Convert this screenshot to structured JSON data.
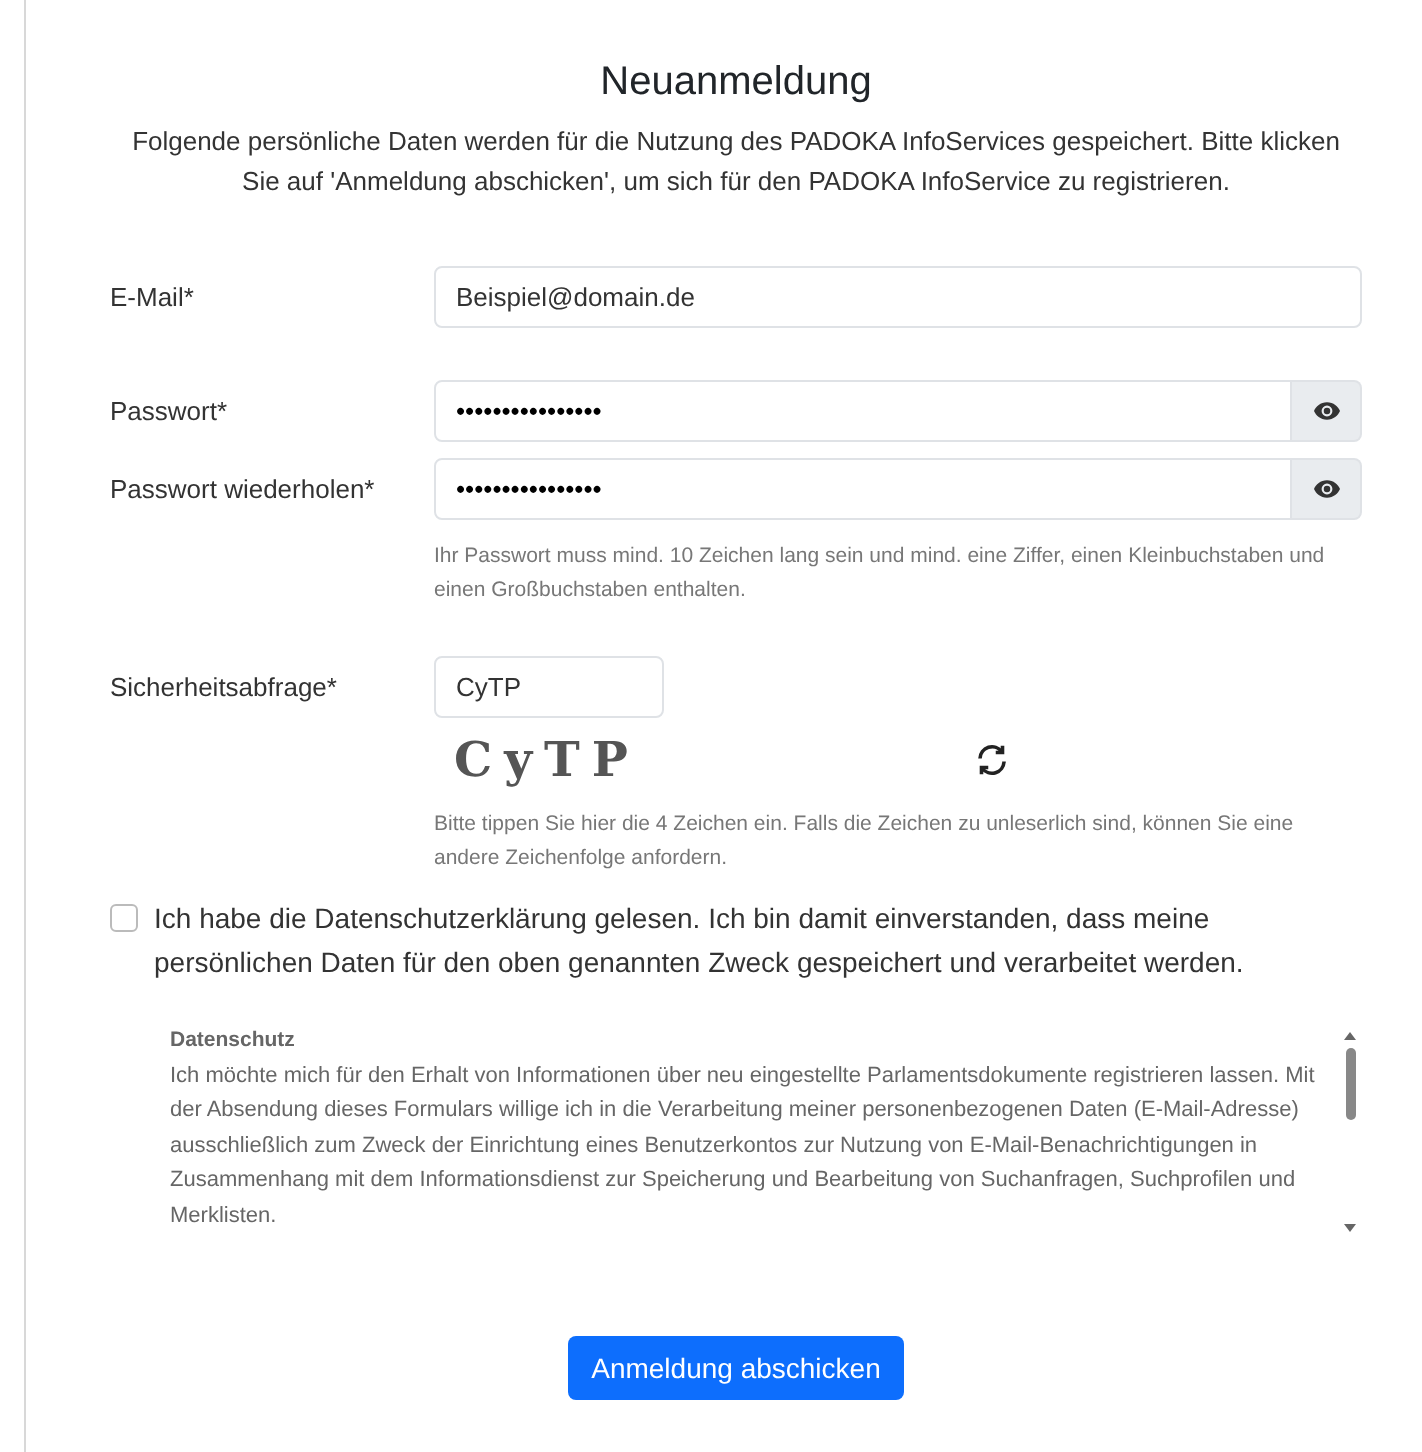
{
  "title": "Neuanmeldung",
  "intro": "Folgende persönliche Daten werden für die Nutzung des PADOKA InfoServices gespeichert. Bitte klicken Sie auf 'Anmeldung abschicken', um sich für den PADOKA InfoService zu registrieren.",
  "fields": [
    {
      "kind": "text",
      "label": "E-Mail*",
      "value": "Beispiel@domain.de"
    },
    {
      "kind": "password",
      "label": "Passwort*",
      "value": "••••••••••••••••"
    },
    {
      "kind": "password",
      "label": "Passwort wiederholen*",
      "value": "••••••••••••••••",
      "hint": "Ihr Passwort muss mind. 10 Zeichen lang sein und mind. eine Ziffer, einen Kleinbuchstaben und einen Großbuchstaben enthalten."
    },
    {
      "kind": "captcha",
      "label": "Sicherheitsabfrage*",
      "value": "CyTP",
      "captcha_text": "CyTP",
      "hint": "Bitte tippen Sie hier die 4 Zeichen ein. Falls die Zeichen zu unleserlich sind, können Sie eine andere Zeichenfolge anfordern."
    }
  ],
  "consent": {
    "checked": false,
    "text": "Ich habe die Datenschutzerklärung gelesen. Ich bin damit einverstanden, dass meine persönlichen Daten für den oben genannten Zweck gespeichert und verarbeitet werden."
  },
  "privacy": {
    "heading": "Datenschutz",
    "text": "Ich möchte mich für den Erhalt von Informationen über neu eingestellte Parlamentsdokumente registrieren lassen. Mit der Absendung dieses Formulars willige ich in die Verarbeitung meiner personenbezogenen Daten (E-Mail-Adresse) ausschließlich zum Zweck der Einrichtung eines Benutzerkontos zur Nutzung von E-Mail-Benachrichtigungen in Zusammenhang mit dem Informationsdienst zur Speicherung und Bearbeitung von Suchanfragen, Suchprofilen und Merklisten."
  },
  "submit": "Anmeldung abschicken"
}
